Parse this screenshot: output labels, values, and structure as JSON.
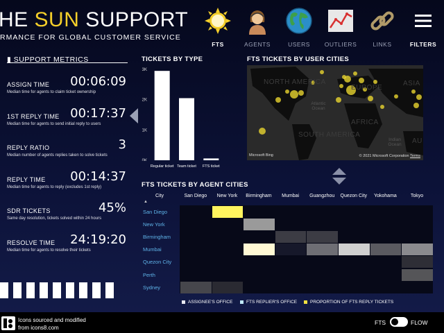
{
  "header": {
    "title_prefix": "HE ",
    "title_sun": "SUN",
    "title_suffix": " SUPPORT",
    "subtitle": "RMANCE FOR GLOBAL CUSTOMER SERVICE",
    "accent_color": "#f5cf2a"
  },
  "nav": {
    "items": [
      {
        "label": "FTS",
        "icon": "sun-icon",
        "active": true
      },
      {
        "label": "AGENTS",
        "icon": "agent-icon",
        "active": false
      },
      {
        "label": "USERS",
        "icon": "globe-icon",
        "active": false
      },
      {
        "label": "OUTLIERS",
        "icon": "line-chart-icon",
        "active": false
      },
      {
        "label": "LINKS",
        "icon": "chain-link-icon",
        "active": false
      },
      {
        "label": "FILTERS",
        "icon": "hamburger-menu-icon",
        "active": false
      }
    ]
  },
  "metrics": {
    "title": "SUPPORT METRICS",
    "items": [
      {
        "name": "ASSIGN TIME",
        "value": "00:06:09",
        "desc": "Median time for agents to claim ticket ownership"
      },
      {
        "name": "1ST REPLY TIME",
        "value": "00:17:37",
        "desc": "Median time for agents to send initial reply to users"
      },
      {
        "name": "REPLY RATIO",
        "value": "3",
        "desc": "Median number of agents replies taken to solve tickets"
      },
      {
        "name": "REPLY TIME",
        "value": "00:14:37",
        "desc": "Median time for agents to reply (excludes 1st reply)"
      },
      {
        "name": "SDR TICKETS",
        "value": "45%",
        "desc": "Same day resolution, tickets solved within 24 hours"
      },
      {
        "name": "RESOLVE TIME",
        "value": "24:19:20",
        "desc": "Median time for agents to resolve their tickets"
      }
    ]
  },
  "tickets_by_type": {
    "title": "TICKETS BY TYPE"
  },
  "chart_data": {
    "type": "bar",
    "categories": [
      "Regular ticket",
      "Team ticket",
      "FTS ticket"
    ],
    "values": [
      2950,
      2050,
      60
    ],
    "ylim": [
      0,
      3000
    ],
    "y_ticks": [
      "0K",
      "1K",
      "2K",
      "3K"
    ],
    "bar_color": "#ffffff",
    "grid": false
  },
  "user_cities": {
    "title": "FTS TICKETS BY USER CITIES",
    "continents": [
      "NORTH AMERICA",
      "EUROPE",
      "ASIA",
      "AFRICA",
      "SOUTH AMERICA",
      "AU"
    ],
    "oceans": [
      "Atlantic Ocean",
      "Indian Ocean"
    ],
    "bing": "Microsoft Bing",
    "attribution": "© 2021 Microsoft Corporation",
    "terms": "Terms",
    "marker_color": "#e8d430"
  },
  "agent_cities": {
    "title": "FTS TICKETS BY AGENT CITIES",
    "header_city": "City",
    "columns": [
      "San Diego",
      "New York",
      "Birmingham",
      "Mumbai",
      "Guangzhou",
      "Quezon City",
      "Yokohama",
      "Tokyo"
    ],
    "rows": [
      "San Diego",
      "New York",
      "Birmingham",
      "Mumbai",
      "Quezon City",
      "Perth",
      "Sydney"
    ],
    "cells": [
      {
        "row": 0,
        "col": 1,
        "color": "#fff45e"
      },
      {
        "row": 1,
        "col": 2,
        "color": "#9a9a9a"
      },
      {
        "row": 2,
        "col": 3,
        "color": "#3c3c44"
      },
      {
        "row": 2,
        "col": 4,
        "color": "#3c3c44"
      },
      {
        "row": 3,
        "col": 2,
        "color": "#fff8d4"
      },
      {
        "row": 3,
        "col": 3,
        "color": "#16182a"
      },
      {
        "row": 3,
        "col": 4,
        "color": "#6e6e74"
      },
      {
        "row": 3,
        "col": 5,
        "color": "#cfcfcf"
      },
      {
        "row": 3,
        "col": 6,
        "color": "#5a5a60"
      },
      {
        "row": 3,
        "col": 7,
        "color": "#8a8a8e"
      },
      {
        "row": 4,
        "col": 7,
        "color": "#2e2e36"
      },
      {
        "row": 5,
        "col": 7,
        "color": "#555558"
      },
      {
        "row": 6,
        "col": 0,
        "color": "#46464c"
      },
      {
        "row": 6,
        "col": 1,
        "color": "#2a2a32"
      }
    ],
    "legend": [
      {
        "label": "ASSIGNEE'S OFFICE",
        "color": "#e8e8f0"
      },
      {
        "label": "FTS REPLIER'S OFFICE",
        "color": "#bfe8f8"
      },
      {
        "label": "PROPORTION OF FTS REPLY TICKETS",
        "color": "#f0e040"
      }
    ]
  },
  "footer": {
    "line1": "Icons sourced and modified",
    "line2": "from icons8.com",
    "toggle_left": "FTS",
    "toggle_right": "FLOW"
  }
}
